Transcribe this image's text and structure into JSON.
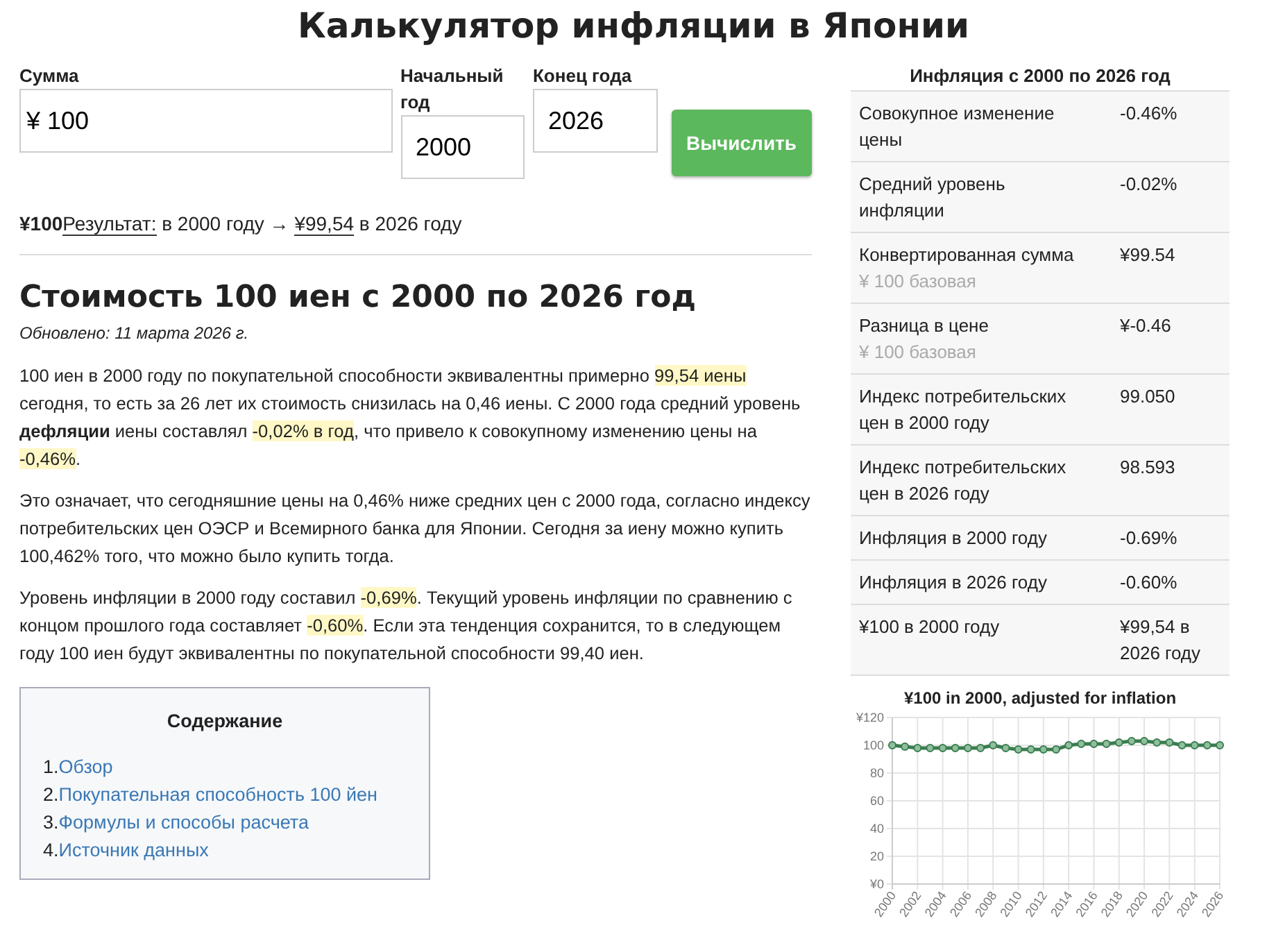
{
  "title": "Калькулятор инфляции в Японии",
  "form": {
    "fields": [
      {
        "label": "Сумма",
        "value": "¥ 100",
        "kind": "wide"
      },
      {
        "label": "Начальный год",
        "value": "2000",
        "kind": "narrow"
      },
      {
        "label": "Конец года",
        "value": "2026",
        "kind": "narrow"
      }
    ],
    "button": "Вычислить"
  },
  "result": {
    "amount": "¥100",
    "link": "Результат:",
    "from": "в 2000 году →",
    "converted": "¥99,54",
    "to": "в 2026 году"
  },
  "article": {
    "heading": "Стоимость 100 иен с 2000 по 2026 год",
    "updated": "Обновлено: 11 марта 2026 г.",
    "paragraphs": [
      [
        {
          "text": "100 иен в 2000 году по покупательной способности эквивалентны примерно ",
          "highlighted": false
        },
        {
          "text": "99,54 иены",
          "highlighted": true
        },
        {
          "text": " сегодня, то есть за 26 лет их стоимость снизилась на 0,46 иены. С 2000 года средний уровень **дефляции** иены составлял ",
          "highlighted": false
        },
        {
          "text": "-0,02% в год",
          "highlighted": true
        },
        {
          "text": ", что привело к совокупному изменению цены на ",
          "highlighted": false
        },
        {
          "text": "-0,46%",
          "highlighted": true
        },
        {
          "text": ".",
          "highlighted": false
        }
      ],
      [
        {
          "text": "Это означает, что сегодняшние цены на 0,46% ниже средних цен с 2000 года, согласно индексу потребительских цен ОЭСР и Всемирного банка для Японии. Сегодня за иену можно купить 100,462% того, что можно было купить тогда.",
          "highlighted": false
        }
      ],
      [
        {
          "text": "Уровень инфляции в 2000 году составил ",
          "highlighted": false
        },
        {
          "text": "-0,69%",
          "highlighted": true
        },
        {
          "text": ". Текущий уровень инфляции по сравнению с концом прошлого года составляет ",
          "highlighted": false
        },
        {
          "text": "-0,60%",
          "highlighted": true
        },
        {
          "text": ". Если эта тенденция сохранится, то в следующем году 100 иен будут эквивалентны по покупательной способности 99,40 иен.",
          "highlighted": false
        }
      ]
    ]
  },
  "toc": {
    "title": "Содержание",
    "items": [
      {
        "number": "1.",
        "label": "Обзор"
      },
      {
        "number": "2.",
        "label": "Покупательная способность 100 йен"
      },
      {
        "number": "3.",
        "label": "Формулы и способы расчета"
      },
      {
        "number": "4.",
        "label": "Источник данных"
      }
    ]
  },
  "summary": {
    "title": "Инфляция с 2000 по 2026 год",
    "rows": [
      {
        "label": "Совокупное изменение цены",
        "value": "-0.46%"
      },
      {
        "label": "Средний уровень инфляции",
        "value": "-0.02%"
      },
      {
        "label": "Конвертированная сумма",
        "note": "¥ 100 базовая",
        "value": "¥99.54"
      },
      {
        "label": "Разница в цене",
        "note": "¥ 100 базовая",
        "value": "¥-0.46"
      },
      {
        "label": "Индекс потребительских цен в 2000 году",
        "value": "99.050"
      },
      {
        "label": "Индекс потребительских цен в 2026 году",
        "value": "98.593"
      },
      {
        "label": "Инфляция в 2000 году",
        "value": "-0.69%"
      },
      {
        "label": "Инфляция в 2026 году",
        "value": "-0.60%"
      },
      {
        "label": "¥100 в 2000 году",
        "value": "¥99,54 в 2026 году"
      }
    ]
  },
  "chart": {
    "chart_data": {
      "type": "line",
      "title": "¥100 in 2000, adjusted for inflation",
      "x": [
        "2000",
        "2001",
        "2002",
        "2003",
        "2004",
        "2005",
        "2006",
        "2007",
        "2008",
        "2009",
        "2010",
        "2011",
        "2012",
        "2013",
        "2014",
        "2015",
        "2016",
        "2017",
        "2018",
        "2019",
        "2020",
        "2021",
        "2022",
        "2023",
        "2024",
        "2025",
        "2026"
      ],
      "series": [
        {
          "color": "#3a7d4f",
          "marker": "circle",
          "values": [
            100,
            99,
            98,
            98,
            98,
            98,
            98,
            98,
            100,
            98,
            97,
            97,
            97,
            97,
            100,
            101,
            101,
            101,
            102,
            103,
            103,
            102,
            102,
            100,
            100,
            100,
            100
          ]
        }
      ],
      "xlim": [
        "2000",
        "2026"
      ],
      "ylim": [
        0,
        120
      ],
      "grid": true,
      "yticks": [
        {
          "value": 0,
          "label": "¥0"
        },
        20,
        40,
        60,
        80,
        100,
        {
          "value": 120,
          "label": "¥120"
        }
      ],
      "xticks": [
        "2000",
        "2002",
        "2004",
        "2006",
        "2008",
        "2010",
        "2012",
        "2014",
        "2016",
        "2018",
        "2020",
        "2022",
        "2024",
        "2026"
      ]
    }
  }
}
